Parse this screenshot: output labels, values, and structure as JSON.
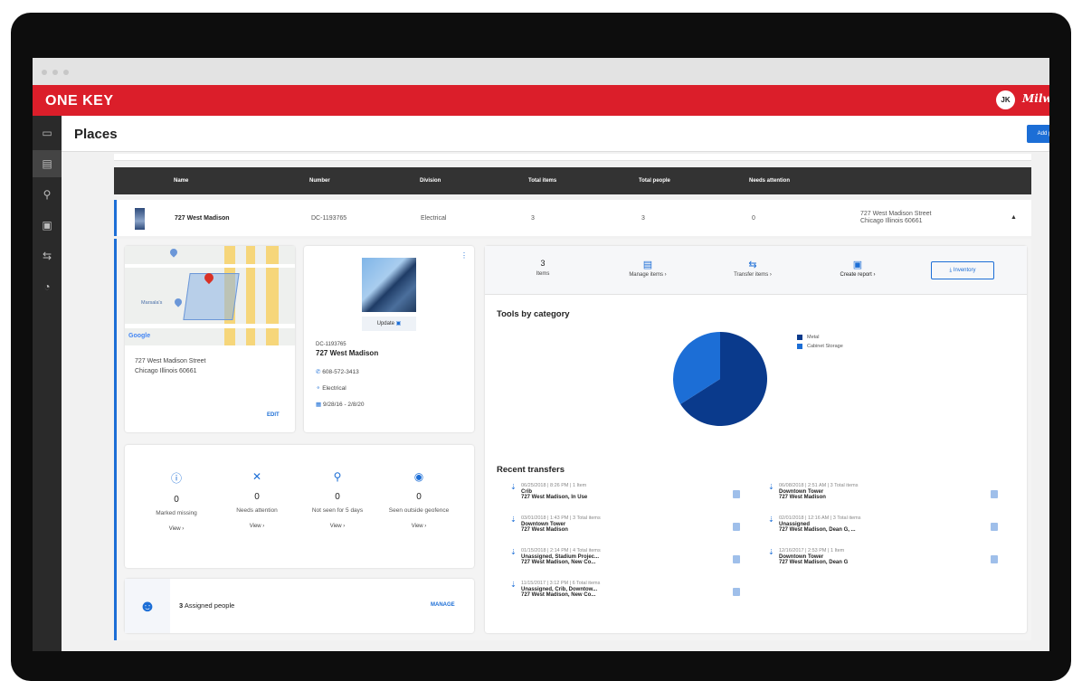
{
  "app": {
    "logo": "ONE⸮KEY",
    "logo_text": "ONE KEY",
    "avatar_initials": "JK",
    "brand": "Milwaukee"
  },
  "sidebar": {
    "items": [
      {
        "name": "tools",
        "icon": "🧰",
        "active": false
      },
      {
        "name": "places",
        "icon": "▭",
        "active": true
      },
      {
        "name": "people",
        "icon": "⚲",
        "active": false
      },
      {
        "name": "reports",
        "icon": "▣",
        "active": false
      },
      {
        "name": "transfers",
        "icon": "⇆",
        "active": false
      },
      {
        "name": "help",
        "icon": "?",
        "active": false
      }
    ]
  },
  "header": {
    "title": "Places",
    "add_button": "Add place"
  },
  "table": {
    "columns": [
      "Name",
      "Number",
      "Division",
      "Total items",
      "Total people",
      "Needs attention"
    ],
    "row": {
      "name": "727 West Madison",
      "number": "DC-1193765",
      "division": "Electrical",
      "total_items": "3",
      "total_people": "3",
      "needs_attention": "0",
      "address_line1": "727 West Madison Street",
      "address_line2": "Chicago Illinois 60661"
    }
  },
  "map_card": {
    "address_line1": "727 West Madison Street",
    "address_line2": "Chicago Illinois 60661",
    "edit": "EDIT",
    "google": "Google",
    "map_label": "Marsala's"
  },
  "place_card": {
    "update": "Update",
    "number": "DC-1193765",
    "name": "727 West Madison",
    "phone": "608-572-3413",
    "division": "Electrical",
    "dates": "9/28/16 - 2/8/20"
  },
  "stats": [
    {
      "icon": "ⓘ",
      "value": "0",
      "label": "Marked missing",
      "view": "View ›"
    },
    {
      "icon": "✕",
      "value": "0",
      "label": "Needs attention",
      "view": "View ›"
    },
    {
      "icon": "⚲",
      "value": "0",
      "label": "Not seen for 5 days",
      "view": "View ›"
    },
    {
      "icon": "◉",
      "value": "0",
      "label": "Seen outside geofence",
      "view": "View ›"
    }
  ],
  "people": {
    "count": "3",
    "label": "Assigned people",
    "manage": "MANAGE"
  },
  "actions": {
    "items_count": "3",
    "items_label": "Items",
    "manage_items": "Manage items ›",
    "transfer_items": "Transfer items ›",
    "create_report": "Create report ›",
    "inventory": "Inventory"
  },
  "chart_data": {
    "type": "pie",
    "title": "Tools by category",
    "series": [
      {
        "name": "Metal",
        "value": 66,
        "color": "#0a3a8c"
      },
      {
        "name": "Cabinet Storage",
        "value": 34,
        "color": "#1c6ed6"
      }
    ]
  },
  "transfers": {
    "title": "Recent transfers",
    "items": [
      {
        "meta": "06/25/2018 | 8:26 PM | 1 Item",
        "from": "Crib",
        "to": "727 West Madison, In Use"
      },
      {
        "meta": "06/08/2018 | 2:51 AM | 3 Total items",
        "from": "Downtown Tower",
        "to": "727 West Madison"
      },
      {
        "meta": "03/01/2018 | 1:43 PM | 3 Total items",
        "from": "Downtown Tower",
        "to": "727 West Madison"
      },
      {
        "meta": "02/01/2018 | 12:16 AM | 3 Total items",
        "from": "Unassigned",
        "to": "727 West Madison, Dean G, ..."
      },
      {
        "meta": "01/15/2018 | 2:14 PM | 4 Total items",
        "from": "Unassigned, Stadium Projec...",
        "to": "727 West Madison, New Co..."
      },
      {
        "meta": "12/16/2017 | 2:53 PM | 1 Item",
        "from": "Downtown Tower",
        "to": "727 West Madison, Dean G"
      },
      {
        "meta": "11/15/2017 | 3:12 PM | 6 Total items",
        "from": "Unassigned, Crib, Downtow...",
        "to": "727 West Madison, New Co..."
      }
    ]
  }
}
